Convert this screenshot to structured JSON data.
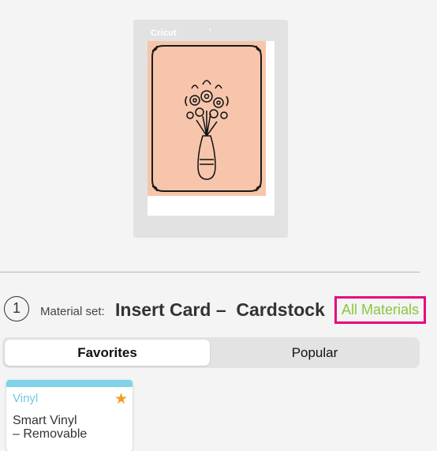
{
  "mat": {
    "logo": "Cricut",
    "mark": "•",
    "card_color": "#f6c5ab"
  },
  "material_set": {
    "step": "1",
    "label": "Material set:",
    "value": "Insert Card –  Cardstock",
    "all_materials": "All Materials",
    "highlight_color": "#e5087e",
    "link_color": "#8cc63f"
  },
  "tabs": {
    "favorites": "Favorites",
    "popular": "Popular",
    "selected": "Favorites"
  },
  "materials": [
    {
      "category": "Vinyl",
      "name_line1": "Smart Vinyl",
      "name_line2": "– Removable",
      "favorite_icon": "star-icon",
      "accent": "#7fd3e8"
    }
  ]
}
